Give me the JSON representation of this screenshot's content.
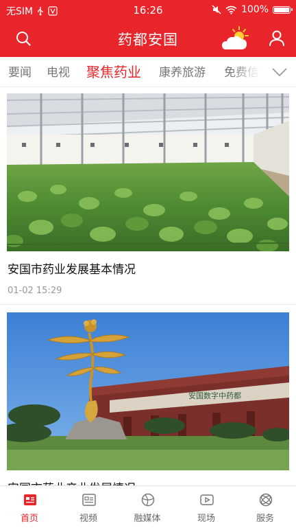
{
  "status_bar": {
    "carrier": "无SIM",
    "time": "16:26",
    "battery": "100%"
  },
  "header": {
    "title": "药都安国",
    "icons": [
      "search-icon",
      "weather-sun-cloud-icon",
      "user-icon"
    ]
  },
  "tabs": [
    {
      "label": "要闻",
      "active": false
    },
    {
      "label": "电视",
      "active": false
    },
    {
      "label": "聚焦药业",
      "active": true
    },
    {
      "label": "康养旅游",
      "active": false
    },
    {
      "label": "免费信",
      "active": false
    }
  ],
  "tabs_more_icon": "chevron-down-icon",
  "articles": [
    {
      "title": "安国市药业发展基本情况",
      "time": "01-02 15:29"
    },
    {
      "title": "安国市药业产业发展情况",
      "time": ""
    }
  ],
  "bottom_nav": [
    {
      "label": "首页",
      "icon": "home-news-icon",
      "active": true
    },
    {
      "label": "视频",
      "icon": "video-icon",
      "active": false
    },
    {
      "label": "融媒体",
      "icon": "globe-icon",
      "active": false
    },
    {
      "label": "现场",
      "icon": "play-icon",
      "active": false
    },
    {
      "label": "服务",
      "icon": "service-icon",
      "active": false
    }
  ],
  "colors": {
    "brand_red": "#e8252b",
    "tab_inactive": "#777777",
    "meta_gray": "#999999"
  }
}
